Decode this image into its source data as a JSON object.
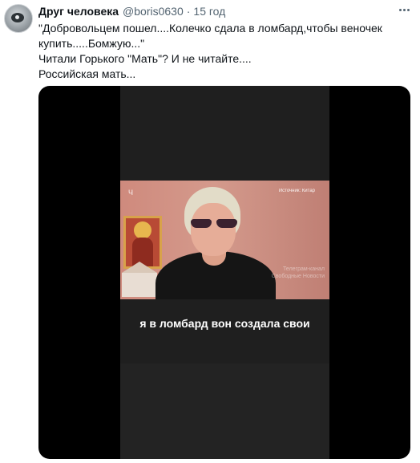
{
  "tweet": {
    "author_name": "Друг человека",
    "handle": "@boris0630",
    "separator": "·",
    "time": "15 год",
    "lines": [
      "\"Добровольцем пошел....Колечко сдала в ломбард,чтобы веночек",
      "купить.....Бомжую...\"",
      "Читали Горького \"Мать\"? И не читайте....",
      "Российская мать..."
    ]
  },
  "video": {
    "channel_logo": "Ч",
    "source_label": "Источник: Китар",
    "watermark": "Телеграм-канал Свободные Новости",
    "subtitle": "я в ломбард вон создала свои"
  },
  "icons": {
    "more": "more-options-icon",
    "avatar": "avatar-image"
  }
}
